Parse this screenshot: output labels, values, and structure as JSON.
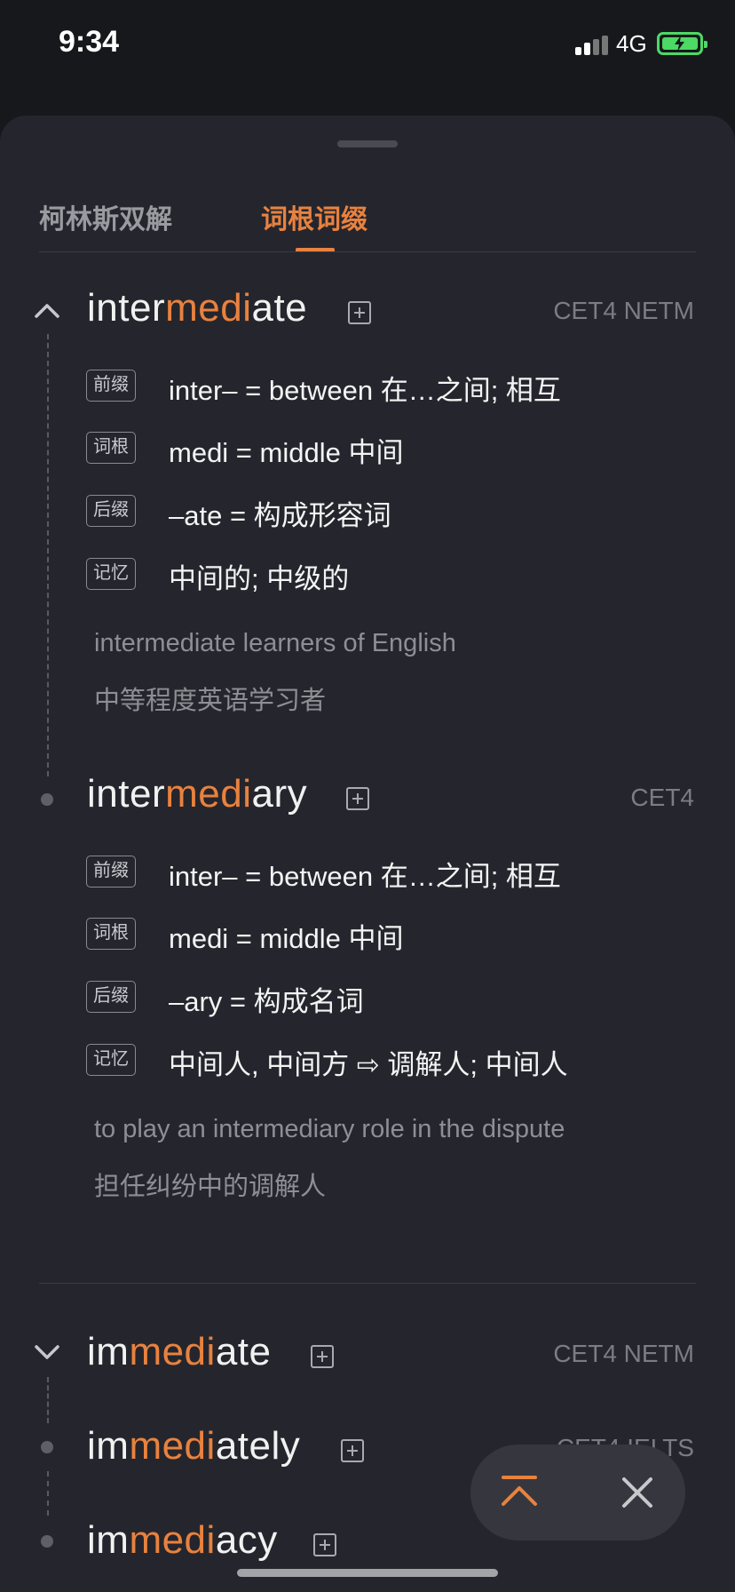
{
  "status": {
    "time": "9:34",
    "network": "4G"
  },
  "tabs": {
    "inactive": "柯林斯双解",
    "active": "词根词缀"
  },
  "entries": [
    {
      "word_prefix": "inter",
      "word_root": "medi",
      "word_suffix": "ate",
      "exam": "CET4 NETM",
      "rows": [
        {
          "tag": "前缀",
          "text": "inter– = between  在…之间; 相互"
        },
        {
          "tag": "词根",
          "text": "medi = middle  中间"
        },
        {
          "tag": "后缀",
          "text": "–ate = 构成形容词"
        },
        {
          "tag": "记忆",
          "text": "中间的; 中级的"
        }
      ],
      "example_en": "intermediate learners of English",
      "example_zh": "中等程度英语学习者"
    },
    {
      "word_prefix": "inter",
      "word_root": "medi",
      "word_suffix": "ary",
      "exam": "CET4",
      "rows": [
        {
          "tag": "前缀",
          "text": "inter– = between  在…之间; 相互"
        },
        {
          "tag": "词根",
          "text": "medi = middle  中间"
        },
        {
          "tag": "后缀",
          "text": "–ary = 构成名词"
        },
        {
          "tag": "记忆",
          "text": "中间人, 中间方  ⇨  调解人; 中间人"
        }
      ],
      "example_en": "to play an intermediary role in the dispute",
      "example_zh": "担任纠纷中的调解人"
    }
  ],
  "group2": [
    {
      "word_prefix": "im",
      "word_root": "medi",
      "word_suffix": "ate",
      "exam": "CET4 NETM"
    },
    {
      "word_prefix": "im",
      "word_root": "medi",
      "word_suffix": "ately",
      "exam": "CET4 IELTS"
    },
    {
      "word_prefix": "im",
      "word_root": "medi",
      "word_suffix": "acy",
      "exam": ""
    }
  ],
  "colors": {
    "accent": "#e8823f",
    "background": "#25262d"
  },
  "icons": {
    "collapse": "chevron-up-icon",
    "expand": "chevron-down-icon",
    "add": "plus-square-icon",
    "top": "scroll-top-icon",
    "close": "close-icon"
  }
}
